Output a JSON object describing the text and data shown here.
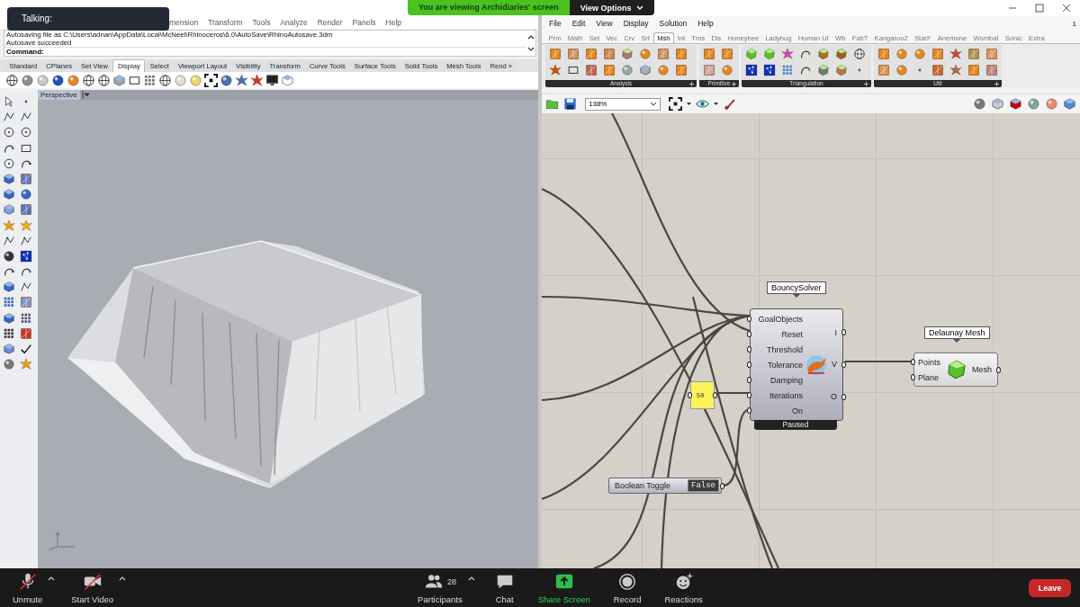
{
  "overlay": {
    "talking": "Talking:",
    "banner": "You are viewing Archidiaries' screen",
    "view_options": "View Options"
  },
  "rhino": {
    "menu": [
      "mension",
      "Transform",
      "Tools",
      "Analyze",
      "Render",
      "Panels",
      "Help"
    ],
    "history": [
      "Autosaving file as C:\\Users\\adnan\\AppData\\Local\\McNeel\\Rhinoceros\\6.0\\AutoSave\\RhinoAutosave.3dm",
      "Autosave succeeded"
    ],
    "command_label": "Command:",
    "tabs": [
      {
        "label": "Standard",
        "selected": false
      },
      {
        "label": "CPlanes",
        "selected": false
      },
      {
        "label": "Set View",
        "selected": false
      },
      {
        "label": "Display",
        "selected": true
      },
      {
        "label": "Select",
        "selected": false
      },
      {
        "label": "Viewport Layout",
        "selected": false
      },
      {
        "label": "Visibility",
        "selected": false
      },
      {
        "label": "Transform",
        "selected": false
      },
      {
        "label": "Curve Tools",
        "selected": false
      },
      {
        "label": "Surface Tools",
        "selected": false
      },
      {
        "label": "Solid Tools",
        "selected": false
      },
      {
        "label": "Mesh Tools",
        "selected": false
      },
      {
        "label": "Rend »",
        "selected": false
      }
    ],
    "viewport": {
      "title": "Perspective"
    }
  },
  "grasshopper": {
    "menu": [
      "File",
      "Edit",
      "View",
      "Display",
      "Solution",
      "Help"
    ],
    "menu_badge": "1",
    "tabs": [
      {
        "label": "Prm",
        "selected": false
      },
      {
        "label": "Math",
        "selected": false
      },
      {
        "label": "Set",
        "selected": false
      },
      {
        "label": "Vec",
        "selected": false
      },
      {
        "label": "Crv",
        "selected": false
      },
      {
        "label": "Srf",
        "selected": false
      },
      {
        "label": "Msh",
        "selected": true
      },
      {
        "label": "Int",
        "selected": false
      },
      {
        "label": "Trns",
        "selected": false
      },
      {
        "label": "Dis",
        "selected": false
      },
      {
        "label": "Honeybee",
        "selected": false
      },
      {
        "label": "Ladybug",
        "selected": false
      },
      {
        "label": "Human UI",
        "selected": false
      },
      {
        "label": "Wb",
        "selected": false
      },
      {
        "label": "FabT",
        "selected": false
      },
      {
        "label": "Kangaroo2",
        "selected": false
      },
      {
        "label": "StarF",
        "selected": false
      },
      {
        "label": "Anemone",
        "selected": false
      },
      {
        "label": "Wombat",
        "selected": false
      },
      {
        "label": "Sonic",
        "selected": false
      },
      {
        "label": "Extra",
        "selected": false
      }
    ],
    "ribbon_groups": [
      {
        "label": "Analysis"
      },
      {
        "label": "Primitive"
      },
      {
        "label": "Triangulation"
      },
      {
        "label": "Util"
      }
    ],
    "zoom": "138%",
    "canvas": {
      "solver": {
        "tag": "BouncySolver",
        "inputs": [
          "GoalObjects",
          "Reset",
          "Threshold",
          "Tolerance",
          "Damping",
          "Iterations",
          "On"
        ],
        "outputs": [
          "I",
          "V",
          "O"
        ],
        "status": "Paused"
      },
      "number": "50",
      "toggle": {
        "label": "Boolean Toggle",
        "value": "False"
      },
      "mesher": {
        "tag": "Delaunay Mesh",
        "inputs": [
          "Points",
          "Plane"
        ],
        "outputs": [
          "Mesh"
        ]
      }
    }
  },
  "meeting_bar": {
    "controls": [
      {
        "kind": "mic",
        "label": "Unmute",
        "crossed": true,
        "menu": true
      },
      {
        "kind": "video",
        "label": "Start Video",
        "crossed": true,
        "menu": true
      },
      {
        "kind": "participants",
        "label": "Participants",
        "count": "28",
        "crossed": false,
        "menu": true
      },
      {
        "kind": "chat",
        "label": "Chat",
        "crossed": false,
        "menu": false
      },
      {
        "kind": "share",
        "label": "Share Screen",
        "crossed": false,
        "menu": false
      },
      {
        "kind": "record",
        "label": "Record",
        "crossed": false,
        "menu": false
      },
      {
        "kind": "reactions",
        "label": "Reactions",
        "crossed": false,
        "menu": false
      }
    ],
    "leave": "Leave"
  }
}
